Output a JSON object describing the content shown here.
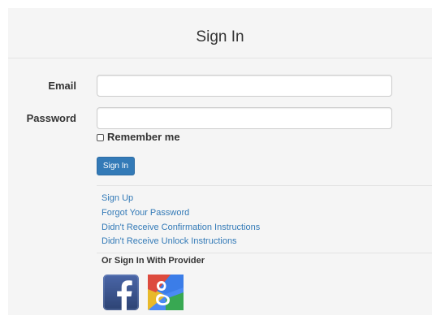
{
  "header": {
    "title": "Sign In"
  },
  "form": {
    "email_label": "Email",
    "email_value": "",
    "email_placeholder": "",
    "password_label": "Password",
    "password_value": "",
    "password_placeholder": "",
    "remember_label": "Remember me",
    "remember_checked": false,
    "submit_label": "Sign In"
  },
  "links": [
    {
      "label": "Sign Up"
    },
    {
      "label": "Forgot Your Password"
    },
    {
      "label": "Didn't Receive Confirmation Instructions"
    },
    {
      "label": "Didn't Receive Unlock Instructions"
    }
  ],
  "providers": {
    "heading": "Or Sign In With Provider",
    "items": [
      {
        "icon": "facebook-icon"
      },
      {
        "icon": "google-icon"
      }
    ]
  },
  "colors": {
    "accent": "#337ab7",
    "panel_background": "#f5f5f5",
    "facebook": "#3b5998"
  }
}
